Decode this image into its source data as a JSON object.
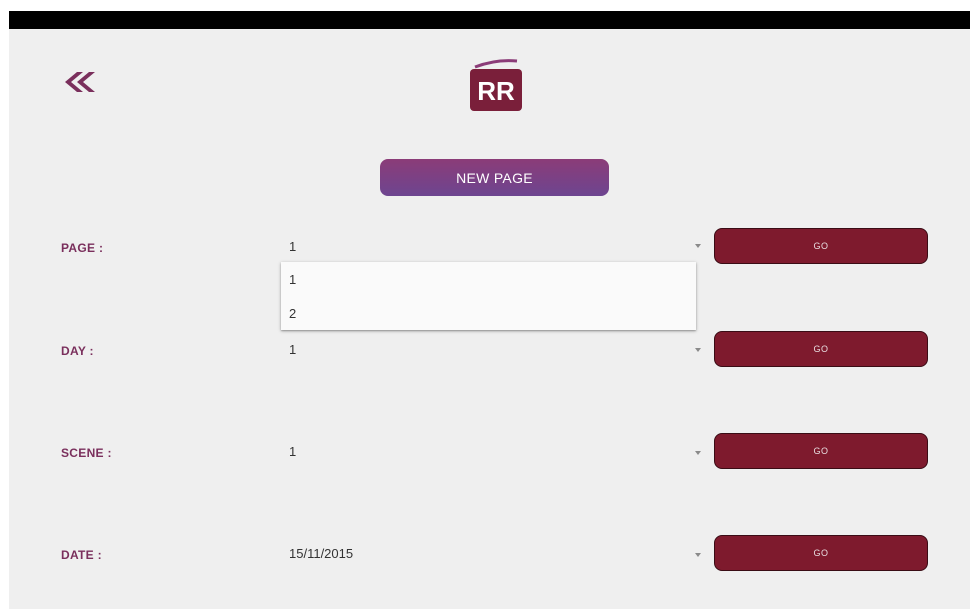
{
  "header": {
    "back_icon": "double-chevron-left-icon",
    "logo_text": "RR",
    "accent_color": "#7a2f5c"
  },
  "new_page_button": {
    "label": "NEW PAGE"
  },
  "rows": [
    {
      "label": "PAGE :",
      "value": "1",
      "go_label": "GO"
    },
    {
      "label": "DAY :",
      "value": "1",
      "go_label": "GO"
    },
    {
      "label": "SCENE :",
      "value": "1",
      "go_label": "GO"
    },
    {
      "label": "DATE :",
      "value": "15/11/2015",
      "go_label": "GO"
    }
  ],
  "page_dropdown": {
    "options": [
      "1",
      "2"
    ]
  },
  "colors": {
    "go_button": "#7e1a2d",
    "label": "#7a2f5c",
    "new_page_gradient_top": "#8b3c78",
    "new_page_gradient_bottom": "#6d4590"
  }
}
